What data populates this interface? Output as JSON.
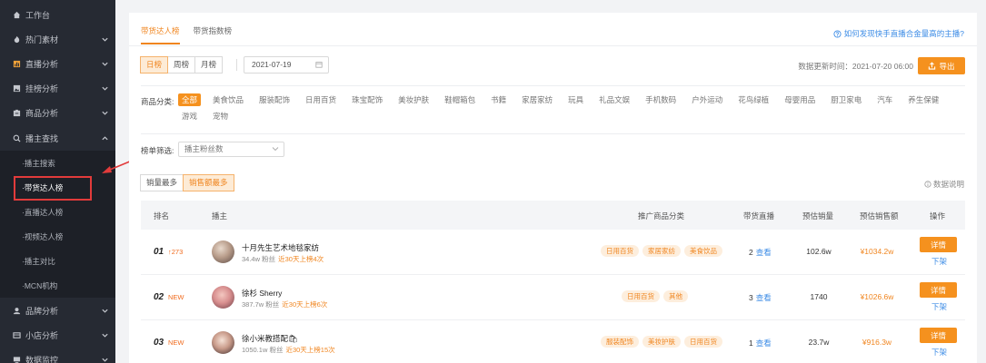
{
  "sidebar": {
    "workspace": "工作台",
    "items": [
      {
        "label": "热门素材",
        "icon": "fire-icon"
      },
      {
        "label": "直播分析",
        "icon": "bar-chart-icon"
      },
      {
        "label": "挂榜分析",
        "icon": "image-icon"
      },
      {
        "label": "商品分析",
        "icon": "box-icon"
      },
      {
        "label": "播主查找",
        "icon": "search-icon"
      }
    ],
    "subitems": [
      "播主搜索",
      "带货达人榜",
      "直播达人榜",
      "视频达人榜",
      "播主对比",
      "MCN机构"
    ],
    "active_sub": "带货达人榜",
    "bottom": [
      {
        "label": "品牌分析",
        "icon": "brand-icon"
      },
      {
        "label": "小店分析",
        "icon": "store-icon"
      },
      {
        "label": "数据监控",
        "icon": "monitor-icon"
      }
    ]
  },
  "tabs": [
    "带货达人榜",
    "带货指数榜"
  ],
  "active_tab": "带货达人榜",
  "help_link": "如何发现快手直播合金量高的主播?",
  "period": {
    "options": [
      "日榜",
      "周榜",
      "月榜"
    ],
    "selected": "日榜"
  },
  "date": "2021-07-19",
  "updated": "数据更新时间：2021-07-20 06:00",
  "export_label": "导出",
  "category": {
    "label": "商品分类:",
    "options": [
      "全部",
      "美食饮品",
      "服装配饰",
      "日用百货",
      "珠宝配饰",
      "美妆护肤",
      "鞋帽箱包",
      "书籍",
      "家居家纺",
      "玩具",
      "礼品文娱",
      "手机数码",
      "户外运动",
      "花鸟绿植",
      "母婴用品",
      "厨卫家电",
      "汽车",
      "养生保健",
      "游戏",
      "宠物"
    ],
    "selected": "全部"
  },
  "filter": {
    "label": "榜单筛选:",
    "value": "播主粉丝数"
  },
  "sort": {
    "options": [
      "销量最多",
      "销售额最多"
    ],
    "selected": "销售额最多"
  },
  "data_note": "数据说明",
  "table": {
    "headers": {
      "rank": "排名",
      "host": "播主",
      "category": "推广商品分类",
      "live": "带货直播",
      "sales": "预估销量",
      "amount": "预估销售额",
      "op": "操作"
    },
    "rows": [
      {
        "rank": "01",
        "change": "↑273",
        "name": "十月先生艺术地毯家纺",
        "fans": "34.4w 粉丝",
        "hot": "近30天上榜4次",
        "tags": [
          "日用百货",
          "家居家纺",
          "美食饮品"
        ],
        "live_count": "2",
        "live_link": "查看",
        "sales": "102.6w",
        "amount": "¥1034.2w",
        "detail": "详情",
        "off": "下架"
      },
      {
        "rank": "02",
        "change": "NEW",
        "name": "徐杉 Sherry",
        "fans": "387.7w 粉丝",
        "hot": "近30天上榜6次",
        "tags": [
          "日用百货",
          "其他"
        ],
        "live_count": "3",
        "live_link": "查看",
        "sales": "1740",
        "amount": "¥1026.6w",
        "detail": "详情",
        "off": "下架"
      },
      {
        "rank": "03",
        "change": "NEW",
        "name": "徐小米教搭配🛍",
        "fans": "1050.1w 粉丝",
        "hot": "近30天上榜15次",
        "tags": [
          "服装配饰",
          "美妆护肤",
          "日用百货"
        ],
        "live_count": "1",
        "live_link": "查看",
        "sales": "23.7w",
        "amount": "¥916.3w",
        "detail": "详情",
        "off": "下架"
      }
    ]
  },
  "colors": {
    "accent": "#f5911e",
    "sidebar_bg": "#262a33",
    "link": "#3d8ce6",
    "highlight": "#e23b3b"
  }
}
